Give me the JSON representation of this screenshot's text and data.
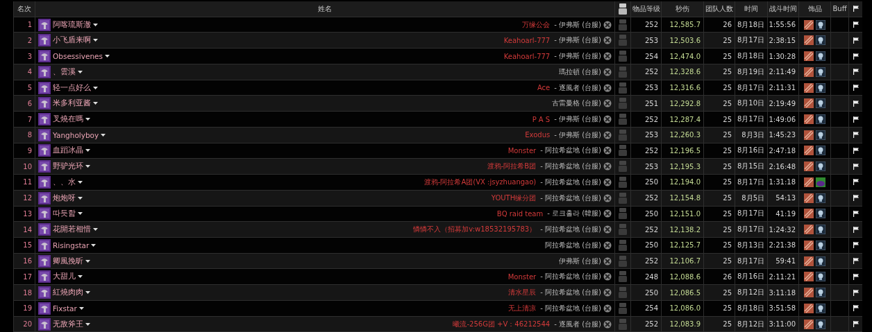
{
  "table": {
    "columns": [
      {
        "label": "名次"
      },
      {
        "label": "姓名"
      },
      {
        "kind": "video-icon"
      },
      {
        "label": "物品等级"
      },
      {
        "label": "秒伤"
      },
      {
        "label": "团队人数"
      },
      {
        "label": "时间"
      },
      {
        "label": "战斗时间"
      },
      {
        "label": "饰品"
      },
      {
        "label": "Buff"
      },
      {
        "kind": "flag-icon"
      }
    ],
    "rows": [
      {
        "rank": "1",
        "name": "阿喀琉斯澈",
        "guild": "万缘公会",
        "server": "- 伊弗斯 (台服)",
        "ilvl": "252",
        "dps": "12,585.7",
        "raid_size": "26",
        "date": "8月18日",
        "duration": "1:55:56",
        "trinkets": [
          {
            "kind": "ribbon"
          },
          {
            "kind": "skull"
          }
        ]
      },
      {
        "rank": "2",
        "name": "小飞盾来啊",
        "guild": "Keahoarl-777",
        "server": "- 伊弗斯 (台服)",
        "ilvl": "253",
        "dps": "12,503.6",
        "raid_size": "25",
        "date": "8月17日",
        "duration": "2:38:15",
        "trinkets": [
          {
            "kind": "ribbon"
          },
          {
            "kind": "skull"
          }
        ]
      },
      {
        "rank": "3",
        "name": "Obsessivenes",
        "guild": "Keahoarl-777",
        "server": "- 伊弗斯 (台服)",
        "ilvl": "254",
        "dps": "12,474.0",
        "raid_size": "25",
        "date": "8月18日",
        "duration": "1:30:28",
        "trinkets": [
          {
            "kind": "ribbon"
          },
          {
            "kind": "skull"
          }
        ]
      },
      {
        "rank": "4",
        "name": "、雲溪",
        "server": "瑪拉頓 (台服)",
        "ilvl": "252",
        "dps": "12,328.6",
        "raid_size": "25",
        "date": "8月19日",
        "duration": "2:11:49",
        "trinkets": [
          {
            "kind": "ribbon"
          },
          {
            "kind": "skull"
          }
        ]
      },
      {
        "rank": "5",
        "name": "轻一点好么",
        "guild": "Ace",
        "server": "- 逐風者 (台服)",
        "ilvl": "253",
        "dps": "12,316.6",
        "raid_size": "25",
        "date": "8月17日",
        "duration": "2:11:31",
        "trinkets": [
          {
            "kind": "ribbon"
          },
          {
            "kind": "skull"
          }
        ]
      },
      {
        "rank": "6",
        "name": "米多利亚酱",
        "server": "古雷曼格 (台服)",
        "ilvl": "251",
        "dps": "12,292.8",
        "raid_size": "25",
        "date": "8月10日",
        "duration": "2:19:49",
        "trinkets": [
          {
            "kind": "ribbon"
          },
          {
            "kind": "skull"
          }
        ]
      },
      {
        "rank": "7",
        "name": "叉燒在嗎",
        "guild": "P A S",
        "server": "- 伊弗斯 (台服)",
        "ilvl": "252",
        "dps": "12,287.4",
        "raid_size": "25",
        "date": "8月17日",
        "duration": "1:49:06",
        "trinkets": [
          {
            "kind": "ribbon"
          },
          {
            "kind": "skull"
          }
        ]
      },
      {
        "rank": "8",
        "name": "Yangholyboy",
        "guild": "Exodus",
        "server": "- 伊弗斯 (台服)",
        "ilvl": "253",
        "dps": "12,260.3",
        "raid_size": "25",
        "date": "8月3日",
        "duration": "1:45:23",
        "trinkets": [
          {
            "kind": "ribbon"
          },
          {
            "kind": "skull"
          }
        ]
      },
      {
        "rank": "9",
        "name": "血蹈冰晶",
        "guild": "Monster",
        "server": "- 阿拉希盆地 (台服)",
        "ilvl": "252",
        "dps": "12,196.5",
        "raid_size": "25",
        "date": "8月16日",
        "duration": "2:47:18",
        "trinkets": [
          {
            "kind": "ribbon"
          },
          {
            "kind": "skull"
          }
        ]
      },
      {
        "rank": "10",
        "name": "野驴光环",
        "guild": "渡鸦-阿拉希B团",
        "server": "- 阿拉希盆地 (台服)",
        "ilvl": "253",
        "dps": "12,195.3",
        "raid_size": "25",
        "date": "8月15日",
        "duration": "2:16:48",
        "trinkets": [
          {
            "kind": "ribbon"
          },
          {
            "kind": "skull"
          }
        ]
      },
      {
        "rank": "11",
        "name": "、、水",
        "guild": "渡鸦-阿拉希A团(VX :jsyzhuangao)",
        "server": "- 阿拉希盆地 (台服)",
        "ilvl": "250",
        "dps": "12,194.0",
        "raid_size": "25",
        "date": "8月17日",
        "duration": "1:31:18",
        "trinkets": [
          {
            "kind": "ribbon"
          },
          {
            "kind": "orb"
          }
        ]
      },
      {
        "rank": "12",
        "name": "炮炮呀",
        "guild": "YOUTH缘分团",
        "server": "- 阿拉希盆地 (台服)",
        "ilvl": "252",
        "dps": "12,154.8",
        "raid_size": "25",
        "date": "8月5日",
        "duration": "54:13",
        "trinkets": [
          {
            "kind": "ribbon"
          },
          {
            "kind": "skull"
          }
        ]
      },
      {
        "rank": "13",
        "name": "따듯함",
        "guild": "BQ raid team",
        "server": "- 로크홀라 (韓服)",
        "ilvl": "250",
        "dps": "12,151.0",
        "raid_size": "25",
        "date": "8月17日",
        "duration": "41:19",
        "trinkets": [
          {
            "kind": "ribbon"
          },
          {
            "kind": "skull"
          }
        ]
      },
      {
        "rank": "14",
        "name": "花開若相惜",
        "guild": "憐憐不入（招募加v:w18532195783）",
        "server": "- 阿拉希盆地 (台服)",
        "ilvl": "252",
        "dps": "12,138.2",
        "raid_size": "25",
        "date": "8月17日",
        "duration": "1:24:32",
        "trinkets": [
          {
            "kind": "ribbon"
          },
          {
            "kind": "skull"
          }
        ]
      },
      {
        "rank": "15",
        "name": "Risingstar",
        "server": "阿拉希盆地 (台服)",
        "ilvl": "250",
        "dps": "12,125.7",
        "raid_size": "25",
        "date": "8月13日",
        "duration": "2:21:38",
        "trinkets": [
          {
            "kind": "ribbon"
          },
          {
            "kind": "skull"
          }
        ]
      },
      {
        "rank": "16",
        "name": "卿風挽昕",
        "server": "伊弗斯 (台服)",
        "ilvl": "252",
        "dps": "12,106.7",
        "raid_size": "25",
        "date": "8月17日",
        "duration": "59:41",
        "trinkets": [
          {
            "kind": "ribbon"
          },
          {
            "kind": "skull"
          }
        ]
      },
      {
        "rank": "17",
        "name": "大甜儿",
        "guild": "Monster",
        "server": "- 阿拉希盆地 (台服)",
        "ilvl": "248",
        "dps": "12,088.6",
        "raid_size": "26",
        "date": "8月16日",
        "duration": "2:11:21",
        "trinkets": [
          {
            "kind": "ribbon"
          },
          {
            "kind": "skull"
          }
        ]
      },
      {
        "rank": "18",
        "name": "紅燒肉肉",
        "guild": "清水星辰",
        "server": "- 阿拉希盆地 (台服)",
        "ilvl": "250",
        "dps": "12,086.5",
        "raid_size": "25",
        "date": "8月12日",
        "duration": "3:11:18",
        "trinkets": [
          {
            "kind": "ribbon"
          },
          {
            "kind": "skull"
          }
        ]
      },
      {
        "rank": "19",
        "name": "Fixstar",
        "guild": "无上清凉",
        "server": "- 阿拉希盆地 (台服)",
        "ilvl": "254",
        "dps": "12,086.0",
        "raid_size": "25",
        "date": "8月18日",
        "duration": "3:51:58",
        "trinkets": [
          {
            "kind": "ribbon"
          },
          {
            "kind": "skull"
          }
        ]
      },
      {
        "rank": "20",
        "name": "无敌斧王",
        "guild": "曦流-256G团 +V：46212544",
        "server": "- 逐風者 (台服)",
        "ilvl": "252",
        "dps": "12,083.9",
        "raid_size": "25",
        "date": "8月12日",
        "duration": "3:11:00",
        "trinkets": [
          {
            "kind": "ribbon"
          },
          {
            "kind": "skull"
          }
        ]
      }
    ]
  }
}
